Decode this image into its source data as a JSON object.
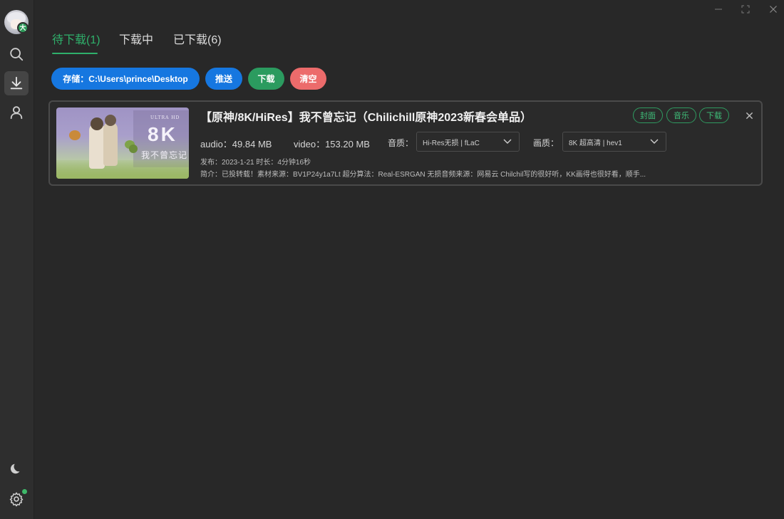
{
  "sidebar": {
    "avatar_badge": "大",
    "items": [
      {
        "icon": "search-icon"
      },
      {
        "icon": "download-icon",
        "active": true
      },
      {
        "icon": "user-icon"
      }
    ],
    "bottom": [
      {
        "icon": "moon-icon"
      },
      {
        "icon": "gear-icon",
        "status_dot_color": "#3fb96a"
      }
    ]
  },
  "window_controls": [
    "minimize-icon",
    "maximize-icon",
    "close-icon"
  ],
  "tabs": [
    {
      "label": "待下载(1)",
      "active": true
    },
    {
      "label": "下载中"
    },
    {
      "label": "已下载(6)"
    }
  ],
  "actions": {
    "storage": "存储：C:\\Users\\prince\\Desktop",
    "push": "推送",
    "download": "下载",
    "clear": "清空"
  },
  "item": {
    "thumbnail": {
      "caption_small": "ULTRA HD",
      "caption_big": "8K",
      "caption_cn": "我不曾忘记"
    },
    "title": "【原神/8K/HiRes】我不曾忘记（Chilichill原神2023新春会单品）",
    "tags": [
      "封面",
      "音乐",
      "下载"
    ],
    "audio": "audio：49.84 MB",
    "video": "video：153.20 MB",
    "audio_quality_label": "音质：",
    "audio_quality_value": "Hi-Res无损 | fLaC",
    "video_quality_label": "画质：",
    "video_quality_value": "8K 超高清 | hev1",
    "published": "发布：2023-1-21  时长：4分钟16秒",
    "description": "简介：已投转载！素材来源：BV1P24y1a7Lt  超分算法：Real-ESRGAN  无损音频来源：网易云 Chilchil写的很好听，KK画得也很好看，顺手..."
  },
  "colors": {
    "accent_green": "#2fb06b",
    "blue": "#1677e0",
    "green": "#2b9b5f",
    "red": "#ec6b6b",
    "background": "#282828"
  }
}
